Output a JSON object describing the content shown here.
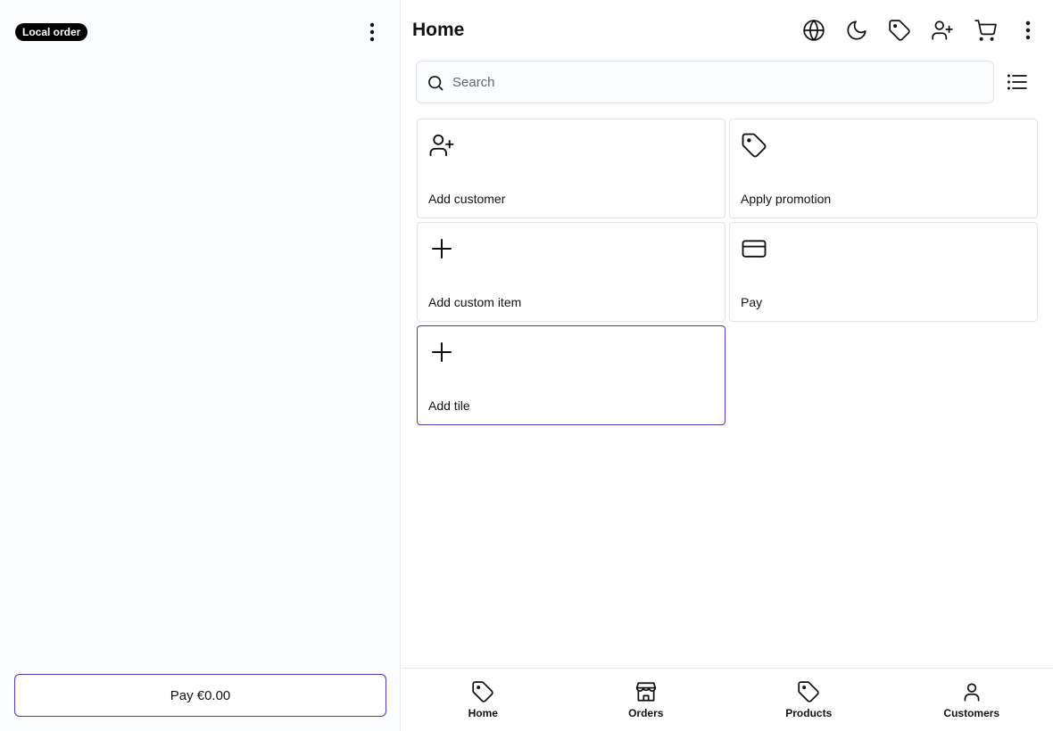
{
  "cart": {
    "order_badge": "Local order",
    "pay_button_label": "Pay €0.00"
  },
  "header": {
    "title": "Home",
    "icons": [
      "globe-icon",
      "moon-icon",
      "tag-icon",
      "user-plus-icon",
      "cart-icon",
      "more-vertical-icon"
    ]
  },
  "search": {
    "placeholder": "Search",
    "value": ""
  },
  "tiles": [
    {
      "label": "Add customer",
      "icon": "user-plus-icon"
    },
    {
      "label": "Apply promotion",
      "icon": "tag-icon"
    },
    {
      "label": "Add custom item",
      "icon": "plus-icon"
    },
    {
      "label": "Pay",
      "icon": "credit-card-icon"
    },
    {
      "label": "Add tile",
      "icon": "plus-icon"
    }
  ],
  "bottom_nav": [
    {
      "label": "Home",
      "icon": "tag-icon"
    },
    {
      "label": "Orders",
      "icon": "store-icon"
    },
    {
      "label": "Products",
      "icon": "tag-icon"
    },
    {
      "label": "Customers",
      "icon": "user-icon"
    }
  ],
  "colors": {
    "accent": "#4b3fa8",
    "cart_background": "#fbfcfd",
    "border": "#e3e5e8"
  }
}
